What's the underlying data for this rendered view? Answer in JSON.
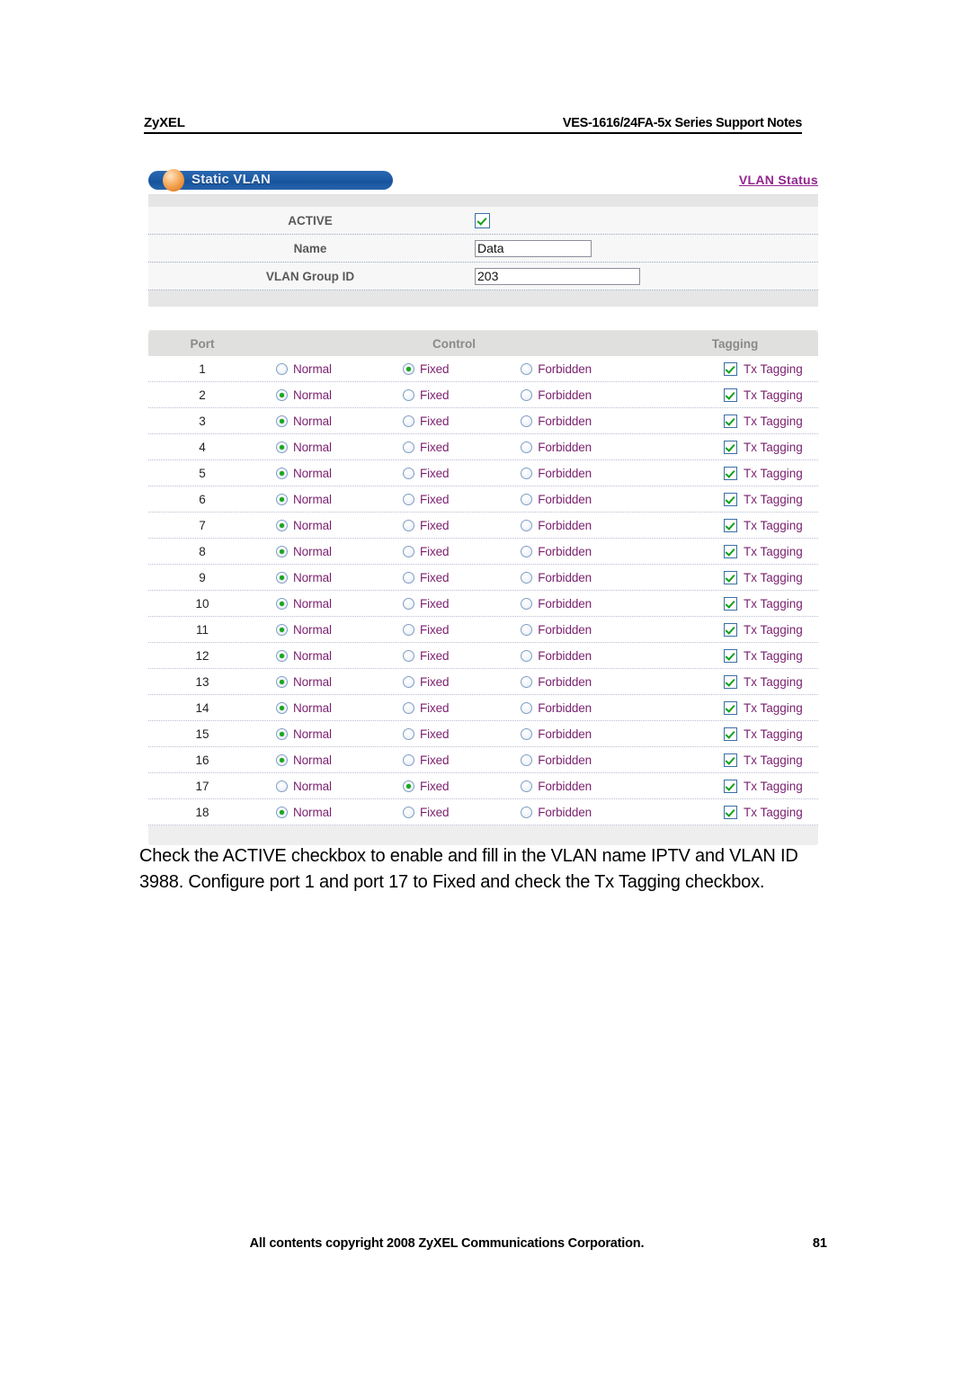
{
  "header": {
    "brand": "ZyXEL",
    "doc_title": "VES-1616/24FA-5x Series Support Notes"
  },
  "panel": {
    "title": "Static VLAN",
    "status_link": "VLAN Status",
    "orb_color": "#ea8c36",
    "titlebar_color": "#1d5ba5",
    "link_color": "#93268f"
  },
  "settings": {
    "active_label": "ACTIVE",
    "active_checked": true,
    "name_label": "Name",
    "name_value": "Data",
    "name_placeholder": "",
    "vlan_group_id_label": "VLAN Group ID",
    "vlan_group_id_value": "203",
    "vlan_group_id_placeholder": ""
  },
  "port_table": {
    "columns": [
      "Port",
      "Control",
      "Tagging"
    ],
    "control_options": [
      "Normal",
      "Fixed",
      "Forbidden"
    ],
    "tagging_label": "Tx Tagging",
    "rows": [
      {
        "port": "1",
        "control": "Fixed",
        "tx_tagging": true
      },
      {
        "port": "2",
        "control": "Normal",
        "tx_tagging": true
      },
      {
        "port": "3",
        "control": "Normal",
        "tx_tagging": true
      },
      {
        "port": "4",
        "control": "Normal",
        "tx_tagging": true
      },
      {
        "port": "5",
        "control": "Normal",
        "tx_tagging": true
      },
      {
        "port": "6",
        "control": "Normal",
        "tx_tagging": true
      },
      {
        "port": "7",
        "control": "Normal",
        "tx_tagging": true
      },
      {
        "port": "8",
        "control": "Normal",
        "tx_tagging": true
      },
      {
        "port": "9",
        "control": "Normal",
        "tx_tagging": true
      },
      {
        "port": "10",
        "control": "Normal",
        "tx_tagging": true
      },
      {
        "port": "11",
        "control": "Normal",
        "tx_tagging": true
      },
      {
        "port": "12",
        "control": "Normal",
        "tx_tagging": true
      },
      {
        "port": "13",
        "control": "Normal",
        "tx_tagging": true
      },
      {
        "port": "14",
        "control": "Normal",
        "tx_tagging": true
      },
      {
        "port": "15",
        "control": "Normal",
        "tx_tagging": true
      },
      {
        "port": "16",
        "control": "Normal",
        "tx_tagging": true
      },
      {
        "port": "17",
        "control": "Fixed",
        "tx_tagging": true
      },
      {
        "port": "18",
        "control": "Normal",
        "tx_tagging": true
      }
    ]
  },
  "body_text": "Check the ACTIVE checkbox to enable and fill in the VLAN name IPTV and VLAN ID 3988. Configure port 1 and port 17 to Fixed and check the Tx Tagging checkbox.",
  "footer": {
    "copyright": "All contents copyright 2008 ZyXEL Communications Corporation.",
    "page_number": "81"
  }
}
